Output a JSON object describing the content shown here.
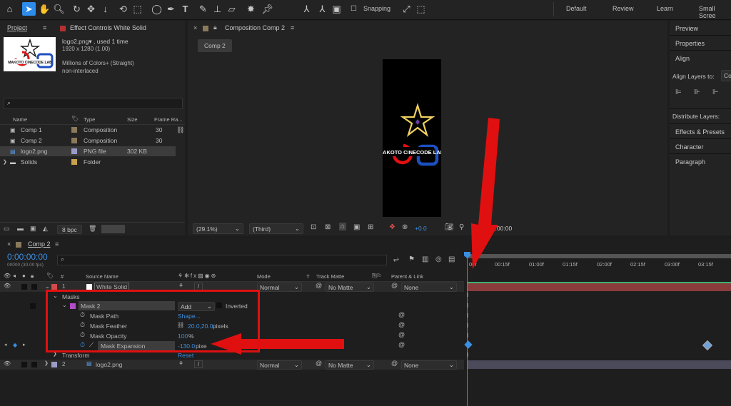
{
  "toolbar": {
    "snapping": "Snapping",
    "workspaces": [
      "Default",
      "Review",
      "Learn",
      "Small Scree"
    ]
  },
  "project": {
    "tab_project": "Project",
    "tab_effect": "Effect Controls White Solid",
    "file_name": "logo2.png▾ , used 1 time",
    "dims": "1920 x 1280 (1.00)",
    "colors": "Millions of Colors+ (Straight)",
    "interlace": "non-interlaced",
    "search_placeholder": "",
    "thumb_text": "MAKOTO CINECODE LAB",
    "columns": {
      "name": "Name",
      "type": "Type",
      "size": "Size",
      "framerate": "Frame Ra..."
    },
    "items": [
      {
        "name": "Comp 1",
        "type": "Composition",
        "size": "",
        "fr": "30",
        "color": "#8a7a5a"
      },
      {
        "name": "Comp 2",
        "type": "Composition",
        "size": "",
        "fr": "30",
        "color": "#8a7a5a"
      },
      {
        "name": "logo2.png",
        "type": "PNG file",
        "size": "302 KB",
        "fr": "",
        "color": "#9b9bc8"
      },
      {
        "name": "Solids",
        "type": "Folder",
        "size": "",
        "fr": "",
        "color": "#c8a24a"
      }
    ],
    "bpc": "8 bpc"
  },
  "comp": {
    "title": "Composition Comp 2",
    "tab": "Comp 2",
    "logo_text": "MAKOTO CINECODE LAB",
    "zoom": "(29.1%)",
    "view": "(Third)",
    "exposure": "+0.0",
    "time": "0:00:00:00"
  },
  "right": {
    "items": [
      "Preview",
      "Properties",
      "Align",
      "Align Layers to:",
      "Distribute Layers:",
      "Effects & Presets",
      "Character",
      "Paragraph"
    ],
    "align_to": "Co"
  },
  "timeline": {
    "tab": "Comp 2",
    "timecode": "0:00:00:00",
    "fps": "00000 (30.00 fps)",
    "cols": {
      "source": "Source Name",
      "mode": "Mode",
      "t": "T",
      "matte": "Track Matte",
      "parent": "Parent & Link"
    },
    "ruler": [
      "00f",
      "00:15f",
      "01:00f",
      "01:15f",
      "02:00f",
      "02:15f",
      "03:00f",
      "03:15f"
    ],
    "layer1": {
      "num": "1",
      "name": "White Solid",
      "mode": "Normal",
      "matte": "No Matte",
      "parent": "None"
    },
    "masks": "Masks",
    "mask2": {
      "name": "Mask 2",
      "mode": "Add",
      "inverted": "Inverted"
    },
    "props": [
      {
        "name": "Mask Path",
        "value": "Shape..."
      },
      {
        "name": "Mask Feather",
        "value": "20.0,20.0",
        "unit": " pixels"
      },
      {
        "name": "Mask Opacity",
        "value": "100",
        "unit": "%"
      },
      {
        "name": "Mask Expansion",
        "value": "-130.0",
        "unit": " pixe"
      }
    ],
    "transform": "Transform",
    "reset": "Reset",
    "layer2": {
      "num": "2",
      "name": "logo2.png",
      "mode": "Normal",
      "matte": "No Matte",
      "parent": "None"
    }
  }
}
